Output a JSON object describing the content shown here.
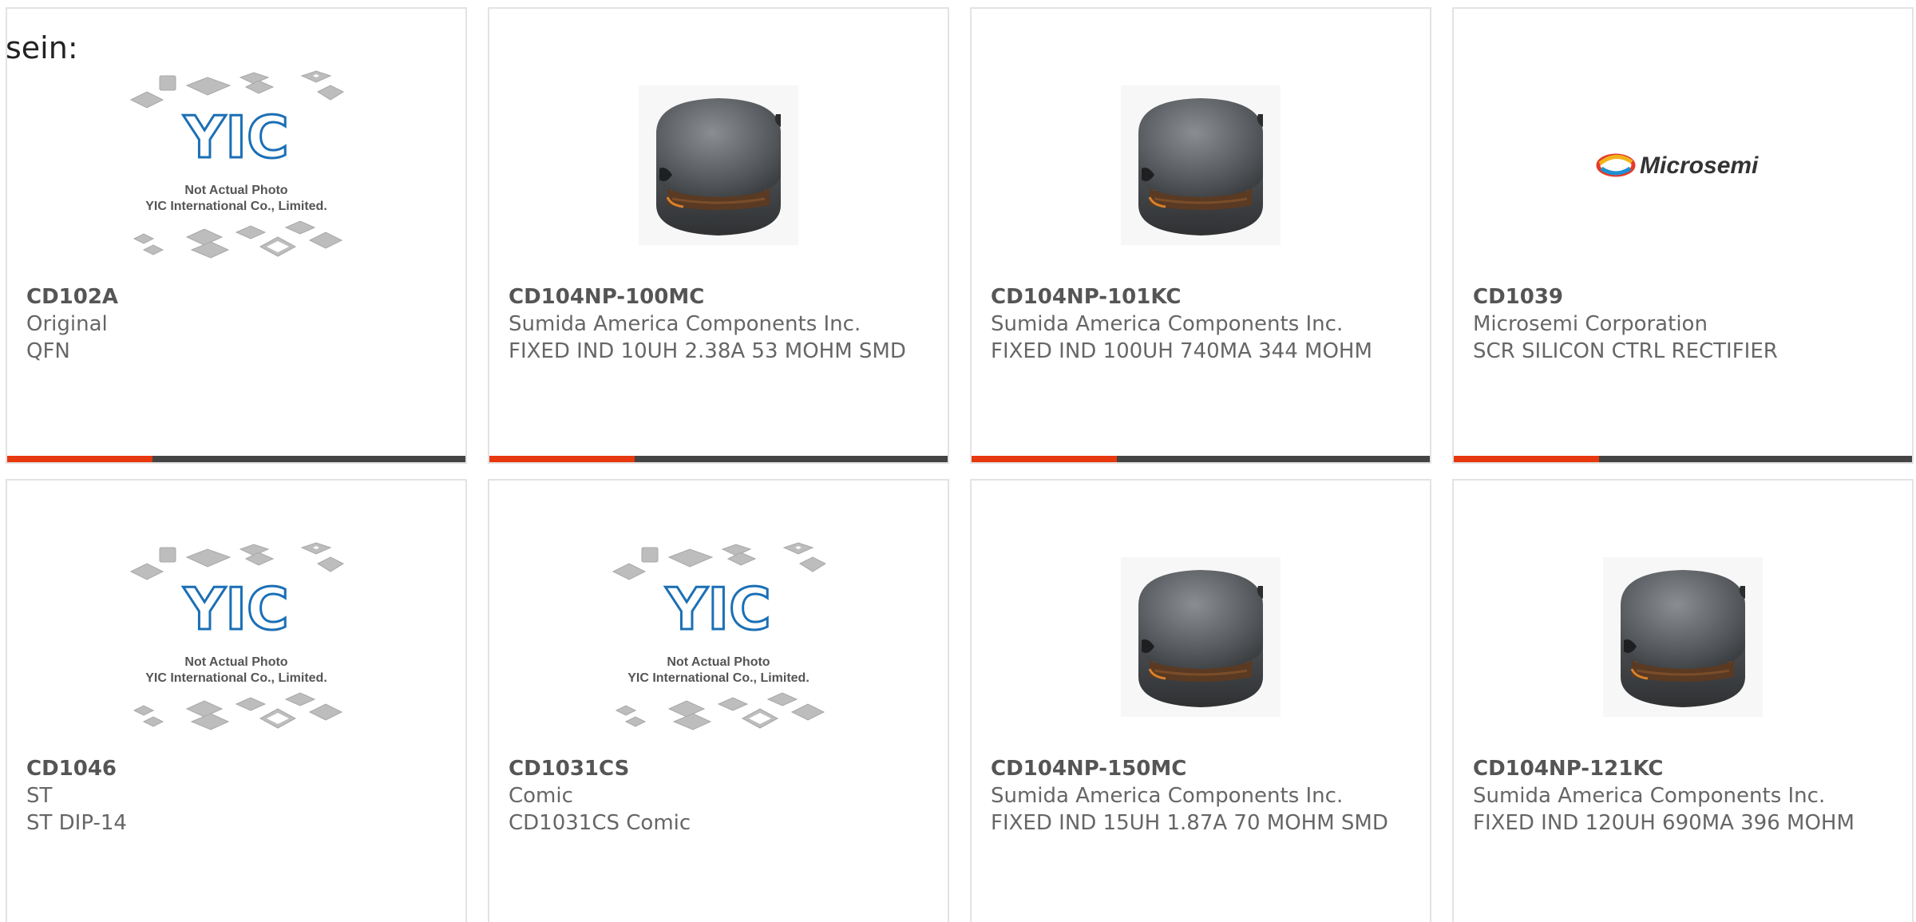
{
  "page": {
    "prefix_text": "sein:"
  },
  "placeholder": {
    "logo_text": "YIC",
    "line1": "Not Actual Photo",
    "line2": "YIC International Co., Limited."
  },
  "brand_logo": {
    "text": "Microsemi"
  },
  "colors": {
    "accent_red": "#e8380d",
    "accent_dark": "#444444",
    "text": "#666666",
    "yic_blue": "#1b6fb5"
  },
  "products": [
    {
      "part": "CD102A",
      "maker": "Original",
      "desc": "QFN",
      "image": "placeholder-icon",
      "accent": true
    },
    {
      "part": "CD104NP-100MC",
      "maker": "Sumida America Components Inc.",
      "desc": "FIXED IND 10UH 2.38A 53 MOHM SMD",
      "image": "inductor-icon",
      "accent": true
    },
    {
      "part": "CD104NP-101KC",
      "maker": "Sumida America Components Inc.",
      "desc": "FIXED IND 100UH 740MA 344 MOHM",
      "image": "inductor-icon",
      "accent": true
    },
    {
      "part": "CD1039",
      "maker": "Microsemi Corporation",
      "desc": "SCR SILICON CTRL RECTIFIER",
      "image": "microsemi-logo",
      "accent": true
    },
    {
      "part": "CD1046",
      "maker": "ST",
      "desc": "ST DIP-14",
      "image": "placeholder-icon",
      "accent": false
    },
    {
      "part": "CD1031CS",
      "maker": "Comic",
      "desc": "CD1031CS Comic",
      "image": "placeholder-icon",
      "accent": false
    },
    {
      "part": "CD104NP-150MC",
      "maker": "Sumida America Components Inc.",
      "desc": "FIXED IND 15UH 1.87A 70 MOHM SMD",
      "image": "inductor-icon",
      "accent": false
    },
    {
      "part": "CD104NP-121KC",
      "maker": "Sumida America Components Inc.",
      "desc": "FIXED IND 120UH 690MA 396 MOHM",
      "image": "inductor-icon",
      "accent": false
    }
  ]
}
